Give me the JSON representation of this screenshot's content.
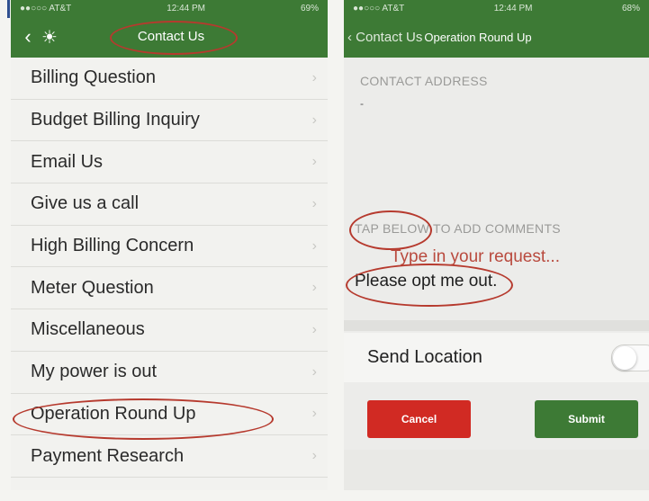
{
  "left_screen": {
    "status": {
      "carrier": "●●○○○ AT&T",
      "time": "12:44 PM",
      "battery": "69%"
    },
    "nav": {
      "back_icon": "chevron-left-icon",
      "sun_icon": "sun-icon",
      "title": "Contact Us"
    },
    "items": [
      {
        "label": "Billing Question"
      },
      {
        "label": "Budget Billing Inquiry"
      },
      {
        "label": "Email Us"
      },
      {
        "label": "Give us a call"
      },
      {
        "label": "High Billing Concern"
      },
      {
        "label": "Meter Question"
      },
      {
        "label": "Miscellaneous"
      },
      {
        "label": "My power is out"
      },
      {
        "label": "Operation Round Up"
      },
      {
        "label": "Payment Research"
      }
    ],
    "chevron": "›"
  },
  "right_screen": {
    "status": {
      "carrier": "●●○○○ AT&T",
      "time": "12:44 PM",
      "battery": "68%"
    },
    "nav": {
      "back_label": "‹ Contact Us",
      "title": "Operation Round Up"
    },
    "contact_address_label": "CONTACT ADDRESS",
    "contact_address_value": "-",
    "comments_label_1": "TAP BELOW",
    "comments_label_2": " TO ADD COMMENTS",
    "request_placeholder": "Type in your request...",
    "request_text": "Please opt me out.",
    "send_location_label": "Send Location",
    "send_location_on": false,
    "cancel_label": "Cancel",
    "submit_label": "Submit"
  },
  "colors": {
    "nav_green": "#3d7a35",
    "annotation_red": "#b63a2e",
    "cancel_red": "#d12a23"
  }
}
